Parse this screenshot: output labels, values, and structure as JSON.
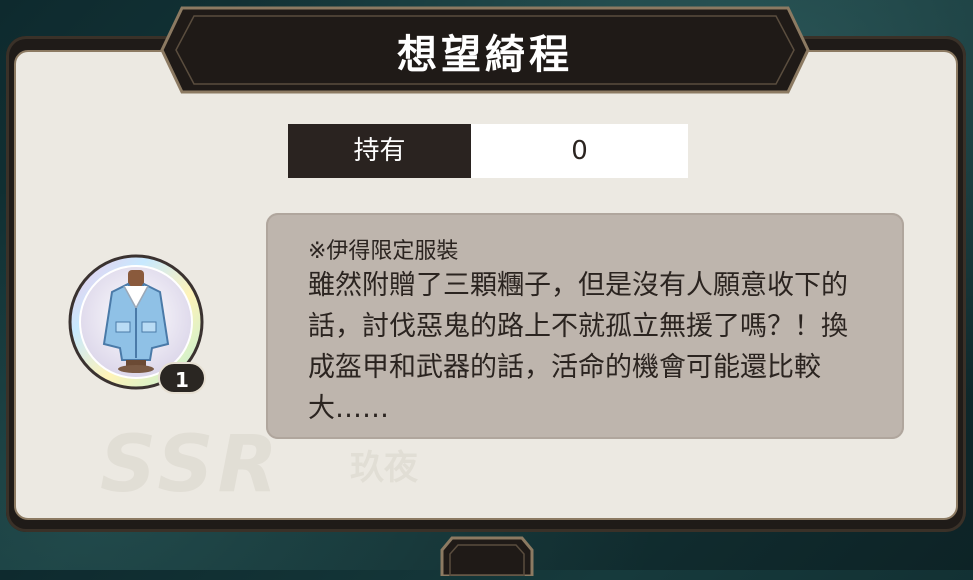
{
  "dialog": {
    "title": "想望綺程"
  },
  "stat": {
    "label": "持有",
    "value": "0"
  },
  "item": {
    "icon": "jacket-icon",
    "count": "1"
  },
  "description": {
    "title": "※伊得限定服裝",
    "body": "雖然附贈了三顆糰子，但是沒有人願意收下的話，討伐惡鬼的路上不就孤立無援了嗎？！換成盔甲和武器的話，活命的機會可能還比較大……"
  },
  "watermark": {
    "rank": "SSR",
    "name": "玖夜"
  },
  "colors": {
    "frame": "#1f1b18",
    "panel": "#ece9e2",
    "desc_bg": "#beb5ad",
    "label_bg": "#2a2320",
    "trim": "#8c7a62"
  }
}
